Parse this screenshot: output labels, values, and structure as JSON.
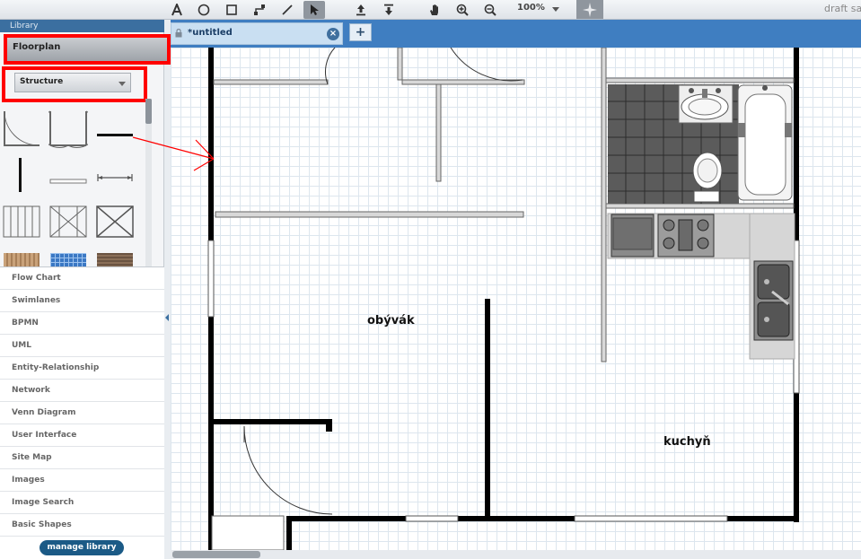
{
  "toolbar": {
    "tools": [
      "text-tool",
      "ellipse-tool",
      "rectangle-tool",
      "connector-tool",
      "line-tool",
      "select-tool",
      "export-tool",
      "import-tool",
      "pan-tool",
      "zoom-in-tool",
      "zoom-out-tool"
    ],
    "zoom_label": "100%",
    "doc_status": "draft sa"
  },
  "library": {
    "header": "Library",
    "selected_library": "Floorplan",
    "category_select": "Structure",
    "categories": [
      "Flow Chart",
      "Swimlanes",
      "BPMN",
      "UML",
      "Entity-Relationship",
      "Network",
      "Venn Diagram",
      "User Interface",
      "Site Map",
      "Images",
      "Image Search",
      "Basic Shapes"
    ],
    "manage_label": "manage library"
  },
  "tabs": {
    "active_tab": "*untitled",
    "close_symbol": "×",
    "add_symbol": "+"
  },
  "canvas": {
    "rooms": {
      "living_room": "obývák",
      "kitchen": "kuchyň"
    }
  },
  "colors": {
    "tab_bar": "#3f7ec1",
    "highlight_red": "#ff0000",
    "manage_button": "#1b5a86"
  }
}
